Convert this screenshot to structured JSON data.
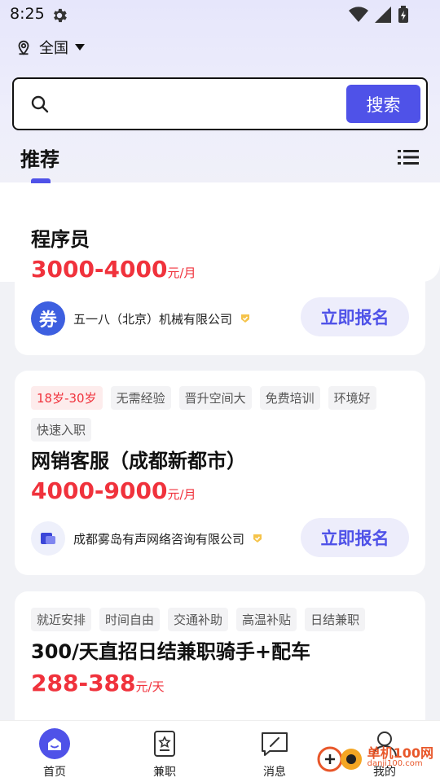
{
  "status": {
    "time": "8:25"
  },
  "location": {
    "label": "全国"
  },
  "search": {
    "placeholder": "",
    "button_label": "搜索"
  },
  "section": {
    "title": "推荐"
  },
  "jobs": [
    {
      "title": "程序员",
      "salary": "3000-4000",
      "unit": "元/月",
      "tags": [],
      "company": "五一八（北京）机械有限公司",
      "logo_text": "券",
      "apply_label": "立即报名"
    },
    {
      "title": "网销客服（成都新都市）",
      "salary": "4000-9000",
      "unit": "元/月",
      "tags": [
        "18岁-30岁",
        "无需经验",
        "晋升空间大",
        "免费培训",
        "环境好",
        "快速入职"
      ],
      "highlight_tag_index": 0,
      "company": "成都雾岛有声网络咨询有限公司",
      "apply_label": "立即报名"
    },
    {
      "title": "300/天直招日结兼职骑手+配车",
      "salary": "288-388",
      "unit": "元/天",
      "tags": [
        "就近安排",
        "时间自由",
        "交通补助",
        "高温补贴",
        "日结兼职"
      ]
    }
  ],
  "nav": [
    {
      "label": "首页",
      "icon": "home-icon",
      "active": true
    },
    {
      "label": "兼职",
      "icon": "parttime-icon",
      "active": false
    },
    {
      "label": "消息",
      "icon": "message-icon",
      "active": false
    },
    {
      "label": "我的",
      "icon": "profile-icon",
      "active": false
    }
  ],
  "watermark": {
    "title": "单机100网",
    "url": "danji100.com"
  },
  "colors": {
    "accent": "#4f52e8",
    "salary": "#f0323c",
    "apply_bg": "#ededfb"
  }
}
